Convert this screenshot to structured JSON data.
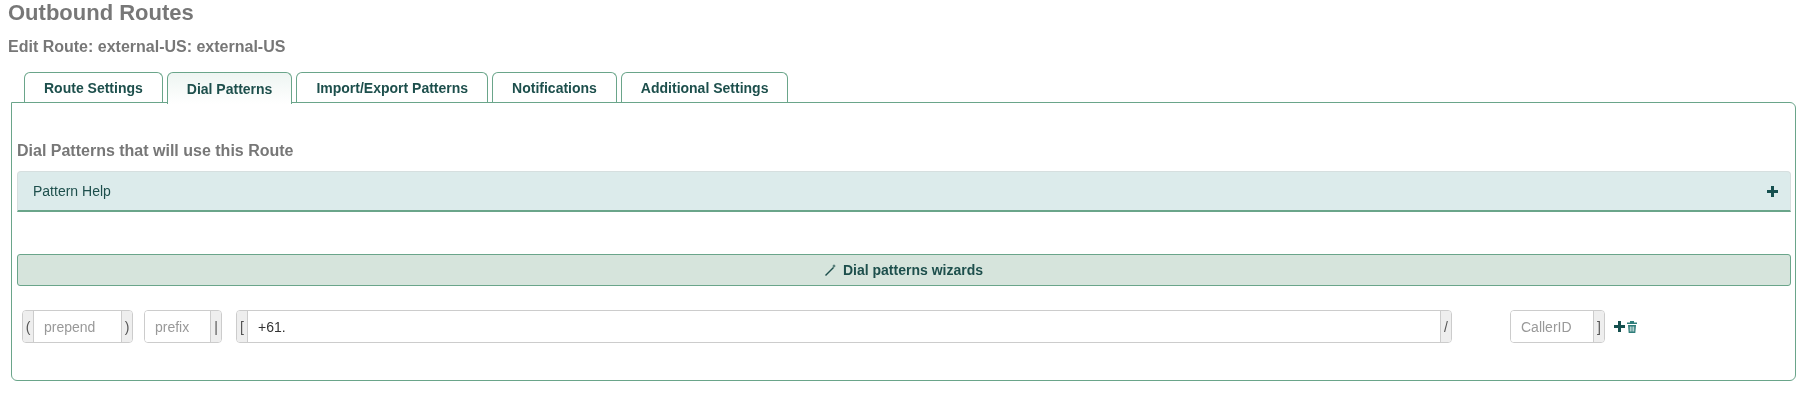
{
  "page": {
    "title": "Outbound Routes",
    "subtitle": "Edit Route: external-US: external-US"
  },
  "tabs": [
    {
      "label": "Route Settings",
      "selected": false
    },
    {
      "label": "Dial Patterns",
      "selected": true
    },
    {
      "label": "Import/Export Patterns",
      "selected": false
    },
    {
      "label": "Notifications",
      "selected": false
    },
    {
      "label": "Additional Settings",
      "selected": false
    }
  ],
  "section_title": "Dial Patterns that will use this Route",
  "pattern_help": {
    "label": "Pattern Help",
    "expanded": false
  },
  "wizard_button": {
    "label": "Dial patterns wizards"
  },
  "pattern_row": {
    "fields": [
      {
        "left": "(",
        "placeholder": "prepend",
        "right": ")"
      },
      {
        "placeholder": "prefix",
        "right": "|"
      },
      {
        "left": "[",
        "value": "+61.",
        "right": "/"
      },
      {
        "placeholder": "CallerID",
        "right": "]"
      }
    ]
  }
}
